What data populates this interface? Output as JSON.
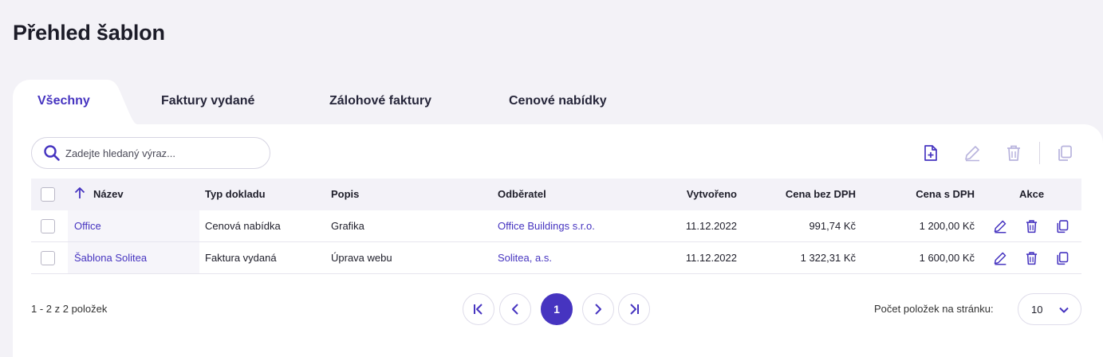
{
  "page": {
    "title": "Přehled šablon"
  },
  "tabs": [
    {
      "label": "Všechny",
      "active": true
    },
    {
      "label": "Faktury vydané",
      "active": false
    },
    {
      "label": "Zálohové faktury",
      "active": false
    },
    {
      "label": "Cenové nabídky",
      "active": false
    }
  ],
  "search": {
    "placeholder": "Zadejte hledaný výraz..."
  },
  "toolbar": {
    "icons": [
      "add-document-icon",
      "edit-icon",
      "delete-icon",
      "copy-icon"
    ]
  },
  "table": {
    "columns": {
      "name": "Název",
      "doc_type": "Typ dokladu",
      "description": "Popis",
      "customer": "Odběratel",
      "created": "Vytvořeno",
      "price_net": "Cena bez DPH",
      "price_gross": "Cena s DPH",
      "actions": "Akce"
    },
    "sort": {
      "column": "name",
      "direction": "asc"
    },
    "rows": [
      {
        "name": "Office",
        "doc_type": "Cenová nabídka",
        "description": "Grafika",
        "customer": "Office Buildings s.r.o.",
        "created": "11.12.2022",
        "price_net": "991,74 Kč",
        "price_gross": "1 200,00 Kč"
      },
      {
        "name": "Šablona Solitea",
        "doc_type": "Faktura vydaná",
        "description": "Úprava webu",
        "customer": "Solitea, a.s.",
        "created": "11.12.2022",
        "price_net": "1 322,31 Kč",
        "price_gross": "1 600,00 Kč"
      }
    ]
  },
  "footer": {
    "count": "1 - 2 z 2 položek",
    "current_page": "1",
    "per_page_label": "Počet položek na stránku:",
    "per_page_value": "10"
  },
  "colors": {
    "accent": "#4634c0",
    "icon_muted": "#b8b3dd",
    "background": "#f3f2f7"
  }
}
